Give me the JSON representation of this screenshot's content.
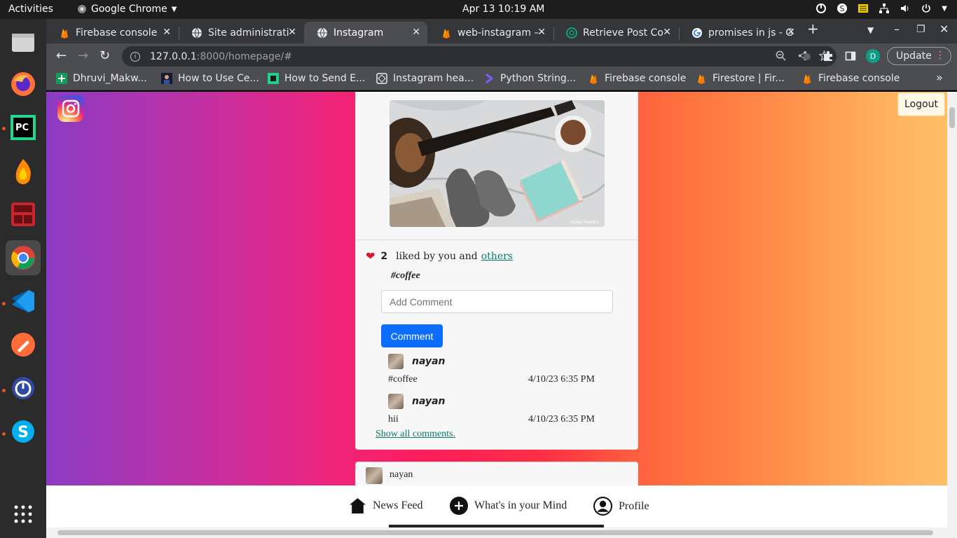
{
  "system": {
    "activities": "Activities",
    "app_name": "Google Chrome",
    "clock": "Apr 13  10:19 AM"
  },
  "browser": {
    "tabs": [
      {
        "title": "Firebase console"
      },
      {
        "title": "Site administrati"
      },
      {
        "title": "Instagram"
      },
      {
        "title": "web-instagram –"
      },
      {
        "title": "Retrieve Post Co"
      },
      {
        "title": "promises in js - G"
      }
    ],
    "active_tab": 2,
    "url_host": "127.0.0.1",
    "url_path": ":8000/homepage/#",
    "profile_initial": "D",
    "update_label": "Update",
    "bookmarks": [
      {
        "label": "Dhruvi_Makw..."
      },
      {
        "label": "How to Use Ce..."
      },
      {
        "label": "How to Send E..."
      },
      {
        "label": "Instagram hea..."
      },
      {
        "label": "Python String..."
      },
      {
        "label": "Firebase console"
      },
      {
        "label": "Firestore | Fir..."
      },
      {
        "label": "Firebase console"
      }
    ],
    "overflow": "»"
  },
  "page": {
    "logout_label": "Logout",
    "post": {
      "like_count": "2",
      "liked_text": "liked by you and",
      "others_link": "others",
      "caption": "#coffee",
      "comment_placeholder": "Add Comment",
      "comment_button": "Comment",
      "comments": [
        {
          "user": "nayan",
          "text": "#coffee",
          "time": "4/10/23 6:35 PM"
        },
        {
          "user": "nayan",
          "text": "hii",
          "time": "4/10/23 6:35 PM"
        }
      ],
      "show_all": "Show all comments.",
      "photo_credit": "Haley Powers"
    },
    "next_post": {
      "user": "nayan"
    },
    "nav": {
      "news_feed": "News Feed",
      "whats_in_mind": "What's in your Mind",
      "profile": "Profile"
    }
  }
}
